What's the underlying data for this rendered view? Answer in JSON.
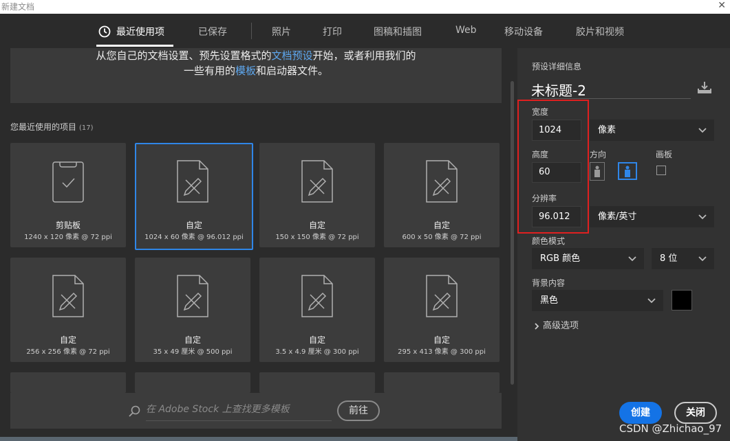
{
  "window": {
    "title": "新建文档"
  },
  "tabs": [
    {
      "label": "最近使用项",
      "active": true
    },
    {
      "label": "已保存"
    },
    {
      "label": "照片"
    },
    {
      "label": "打印"
    },
    {
      "label": "图稿和插图"
    },
    {
      "label": "Web"
    },
    {
      "label": "移动设备"
    },
    {
      "label": "胶片和视频"
    }
  ],
  "intro": {
    "line1_a": "从您自己的文档设置、预先设置格式的",
    "line1_link": "文档预设",
    "line1_b": "开始，或者利用我们的",
    "line2_a": "一些有用的",
    "line2_link": "模板",
    "line2_b": "和启动器文件。"
  },
  "recent": {
    "label": "您最近使用的项目",
    "count": "(17)"
  },
  "items": [
    {
      "name": "剪贴板",
      "dims": "1240 x 120 像素 @ 72 ppi",
      "icon": "clipboard-icon"
    },
    {
      "name": "自定",
      "dims": "1024 x 60 像素 @ 96.012 ppi",
      "icon": "custom-doc-icon",
      "selected": true
    },
    {
      "name": "自定",
      "dims": "150 x 150 像素 @ 72 ppi",
      "icon": "custom-doc-icon"
    },
    {
      "name": "自定",
      "dims": "600 x 50 像素 @ 72 ppi",
      "icon": "custom-doc-icon"
    },
    {
      "name": "自定",
      "dims": "256 x 256 像素 @ 72 ppi",
      "icon": "custom-doc-icon"
    },
    {
      "name": "自定",
      "dims": "35 x 49 厘米 @ 500 ppi",
      "icon": "custom-doc-icon"
    },
    {
      "name": "自定",
      "dims": "3.5 x 4.9 厘米 @ 300 ppi",
      "icon": "custom-doc-icon"
    },
    {
      "name": "自定",
      "dims": "295 x 413 像素 @ 300 ppi",
      "icon": "custom-doc-icon"
    }
  ],
  "search": {
    "placeholder": "在 Adobe Stock 上查找更多模板",
    "go_label": "前往"
  },
  "details": {
    "heading": "预设详细信息",
    "doc_name": "未标题-2",
    "width_label": "宽度",
    "width_value": "1024",
    "width_unit": "像素",
    "height_label": "高度",
    "height_value": "60",
    "orientation_label": "方向",
    "artboard_label": "画板",
    "resolution_label": "分辨率",
    "resolution_value": "96.012",
    "resolution_unit": "像素/英寸",
    "color_mode_label": "颜色模式",
    "color_mode": "RGB 颜色",
    "bit_depth": "8 位",
    "background_label": "背景内容",
    "background": "黑色",
    "background_color": "#000000",
    "advanced_label": "高级选项"
  },
  "buttons": {
    "create": "创建",
    "close": "关闭"
  },
  "watermark": "CSDN @Zhichao_97",
  "colors": {
    "accent": "#1473e6",
    "highlight_box": "#e02020"
  }
}
